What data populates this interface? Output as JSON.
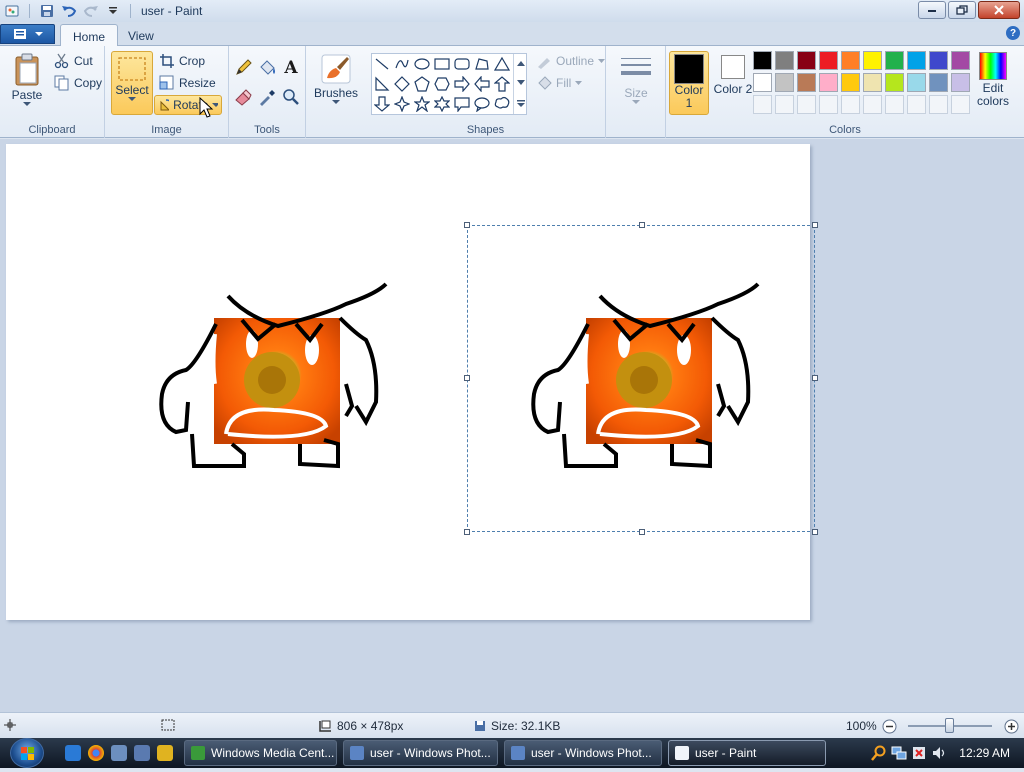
{
  "window": {
    "title": "user - Paint"
  },
  "tabs": [
    {
      "label": "Home",
      "active": true
    },
    {
      "label": "View",
      "active": false
    }
  ],
  "ribbon": {
    "clipboard": {
      "label": "Clipboard",
      "paste": "Paste",
      "cut": "Cut",
      "copy": "Copy"
    },
    "image": {
      "label": "Image",
      "select": "Select",
      "crop": "Crop",
      "resize": "Resize",
      "rotate": "Rotate"
    },
    "tools": {
      "label": "Tools"
    },
    "brushes": {
      "label": "Brushes"
    },
    "shapes": {
      "label": "Shapes",
      "outline": "Outline",
      "fill": "Fill"
    },
    "size": {
      "label": "Size"
    },
    "colors": {
      "label": "Colors",
      "color1": "Color 1",
      "color2": "Color 2",
      "edit": "Edit colors",
      "palette_row1": [
        "#000000",
        "#7f7f7f",
        "#880015",
        "#ed1c24",
        "#ff7f27",
        "#fff200",
        "#22b14c",
        "#00a2e8",
        "#3f48cc",
        "#a349a4"
      ],
      "palette_row2": [
        "#ffffff",
        "#c3c3c3",
        "#b97a57",
        "#ffaec9",
        "#ffc90e",
        "#efe4b0",
        "#b5e61d",
        "#99d9ea",
        "#7092be",
        "#c8bfe7"
      ]
    }
  },
  "status": {
    "canvas_size": "806 × 478px",
    "file_size": "Size: 32.1KB",
    "zoom": "100%"
  },
  "taskbar": {
    "tasks": [
      "Windows Media Cent...",
      "user - Windows Phot...",
      "user - Windows Phot...",
      "user - Paint"
    ],
    "clock": "12:29 AM"
  }
}
